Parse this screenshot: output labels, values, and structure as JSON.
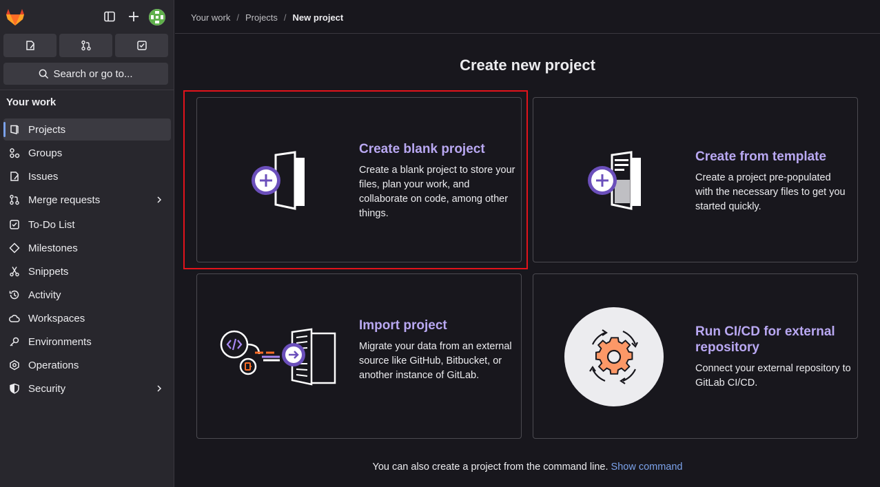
{
  "sidebar": {
    "search_label": "Search or go to...",
    "section_title": "Your work",
    "items": [
      {
        "label": "Projects"
      },
      {
        "label": "Groups"
      },
      {
        "label": "Issues"
      },
      {
        "label": "Merge requests"
      },
      {
        "label": "To-Do List"
      },
      {
        "label": "Milestones"
      },
      {
        "label": "Snippets"
      },
      {
        "label": "Activity"
      },
      {
        "label": "Workspaces"
      },
      {
        "label": "Environments"
      },
      {
        "label": "Operations"
      },
      {
        "label": "Security"
      }
    ]
  },
  "breadcrumb": {
    "items": [
      "Your work",
      "Projects",
      "New project"
    ]
  },
  "main": {
    "title": "Create new project",
    "cards": [
      {
        "title": "Create blank project",
        "description": "Create a blank project to store your files, plan your work, and collaborate on code, among other things."
      },
      {
        "title": "Create from template",
        "description": "Create a project pre-populated with the necessary files to get you started quickly."
      },
      {
        "title": "Import project",
        "description": "Migrate your data from an external source like GitHub, Bitbucket, or another instance of GitLab."
      },
      {
        "title": "Run CI/CD for external repository",
        "description": "Connect your external repository to GitLab CI/CD."
      }
    ],
    "footer_text": "You can also create a project from the command line.",
    "footer_link": "Show command"
  },
  "colors": {
    "accent": "#b9a8f2",
    "link": "#7ba2ea",
    "highlight": "#e3131b",
    "sidebar_bg": "#28272d",
    "page_bg": "#18171d"
  }
}
